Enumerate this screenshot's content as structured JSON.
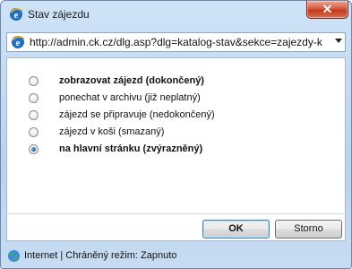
{
  "window": {
    "title": "Stav zájezdu",
    "close_symbol": "✕"
  },
  "address": {
    "url": "http://admin.ck.cz/dlg.asp?dlg=katalog-stav&sekce=zajezdy-k"
  },
  "options": [
    {
      "label": "zobrazovat zájezd (dokončený)",
      "bold": true,
      "checked": false
    },
    {
      "label": "ponechat v archivu (již neplatný)",
      "bold": false,
      "checked": false
    },
    {
      "label": "zájezd se připravuje (nedokončený)",
      "bold": false,
      "checked": false
    },
    {
      "label": "zájezd v koši (smazaný)",
      "bold": false,
      "checked": false
    },
    {
      "label": "na hlavní stránku (zvýrazněný)",
      "bold": true,
      "checked": true
    }
  ],
  "buttons": {
    "ok": "OK",
    "cancel": "Storno"
  },
  "status": {
    "text": "Internet | Chráněný režim: Zapnuto"
  },
  "colors": {
    "accent": "#1e5fa8",
    "close": "#c23a1d"
  },
  "icons": {
    "title": "ie-icon",
    "address": "ie-icon",
    "status": "globe-icon"
  }
}
